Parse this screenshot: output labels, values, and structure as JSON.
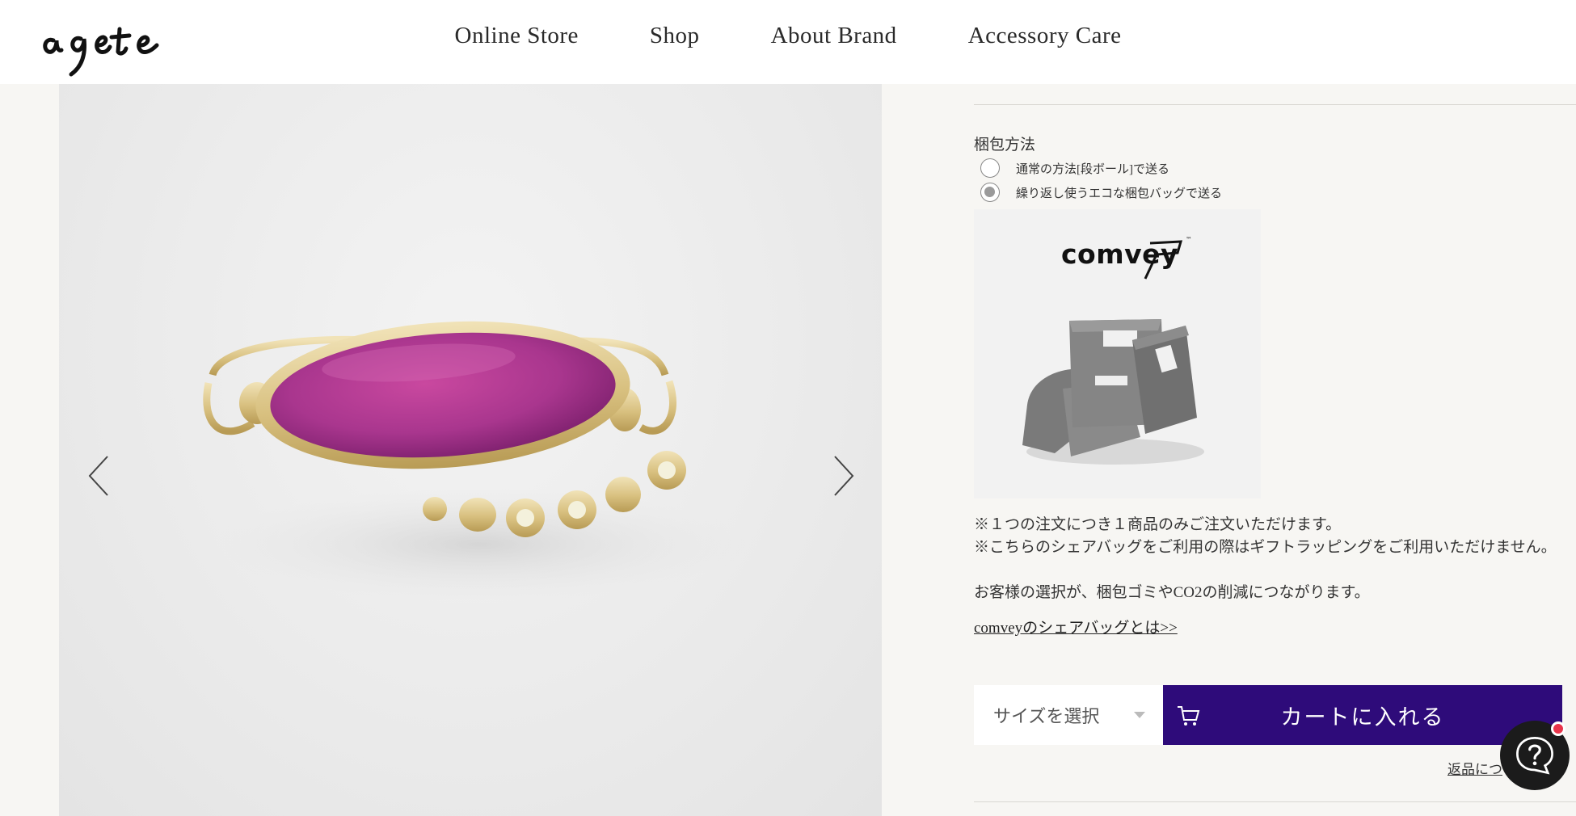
{
  "header": {
    "logo_text": "agete",
    "nav": [
      "Online Store",
      "Shop",
      "About Brand",
      "Accessory Care"
    ]
  },
  "gallery": {
    "prev_icon": "chevron-left-icon",
    "next_icon": "chevron-right-icon"
  },
  "packaging": {
    "label": "梱包方法",
    "options": [
      {
        "label": "通常の方法[段ボール]で送る",
        "selected": false
      },
      {
        "label": "繰り返し使うエコな梱包バッグで送る",
        "selected": true
      }
    ],
    "image_brand": "comvey"
  },
  "notes": {
    "line1": "※１つの注文につき１商品のみご注文いただけます。",
    "line2": "※こちらのシェアバッグをご利用の際はギフトラッピングをご利用いただけません。",
    "line3": "お客様の選択が、梱包ゴミやCO2の削減につながります。",
    "link": "comveyのシェアバッグとは>>"
  },
  "purchase": {
    "size_placeholder": "サイズを選択",
    "cart_label": "カートに入れる",
    "cart_icon": "cart-icon",
    "return_link": "返品につ"
  },
  "colors": {
    "cart_bg": "#2e0b7a",
    "notification": "#e8344a",
    "gem": "#b23a9a"
  }
}
